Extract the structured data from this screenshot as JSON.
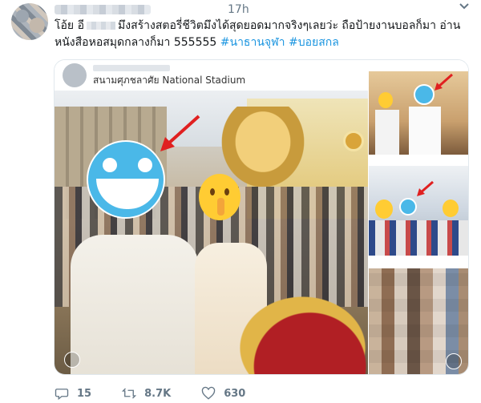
{
  "tweet": {
    "time": "17h",
    "text_line1": "โอ้ย อี",
    "text_line1b": "มึงสร้างสตอรี่ชีวิตมึงได้สุดยอดมากจริงๆเลยว่ะ ถือป้ายงานบอลก็มา อ่าน",
    "text_line2": "หนังสือหอสมุดกลางก็มา 555555",
    "hashtag1": "#นาธานจุฬา",
    "hashtag2": "#บอยสกล"
  },
  "post": {
    "location": "สนามศุภชลาศัย National Stadium"
  },
  "actions": {
    "replies": "15",
    "retweets": "8.7K",
    "likes": "630"
  },
  "colors": {
    "hashtag": "#1b95e0",
    "meta": "#657786",
    "arrow": "#e02020",
    "emoji_blue": "#4ab8e8",
    "emoji_yellow": "#ffcc33"
  }
}
